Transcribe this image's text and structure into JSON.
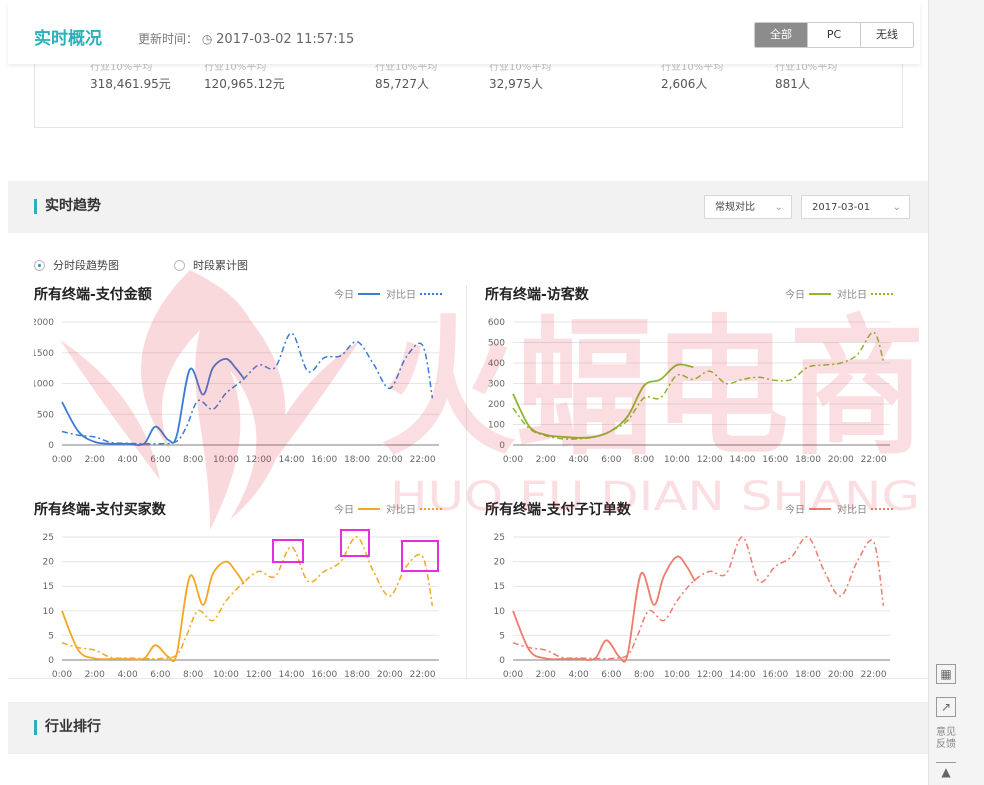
{
  "header": {
    "title": "实时概况",
    "updated_label": "更新时间：",
    "updated_time": "2017-03-02 11:57:15",
    "tabs": [
      "全部",
      "PC",
      "无线"
    ]
  },
  "metrics": [
    {
      "label": "行业10%平均",
      "value": "318,461.95元"
    },
    {
      "label": "行业10%平均",
      "value": "120,965.12元"
    },
    {
      "label": "行业10%平均",
      "value": "85,727人"
    },
    {
      "label": "行业10%平均",
      "value": "32,975人"
    },
    {
      "label": "行业10%平均",
      "value": "2,606人"
    },
    {
      "label": "行业10%平均",
      "value": "881人"
    }
  ],
  "trend": {
    "title": "实时趋势",
    "compare_select": "常规对比",
    "date_select": "2017-03-01",
    "radio_options": [
      "分时段趋势图",
      "时段累计图"
    ],
    "radio_selected": "分时段趋势图"
  },
  "legend": {
    "today": "今日",
    "compare": "对比日"
  },
  "colors": {
    "accent": "#2bb0b8",
    "blue": "#3a7bd5",
    "green": "#8db82e",
    "orange": "#f5a623",
    "red": "#f07a6b",
    "highlight": "#e52ee0"
  },
  "watermark": {
    "text_cn": "火蝠电商",
    "text_en": "HUO FU DIAN SHANG"
  },
  "rank": {
    "title": "行业排行"
  },
  "side_tools": [
    {
      "icon": "qrcode-icon",
      "label": ""
    },
    {
      "icon": "share-icon",
      "label": ""
    },
    {
      "icon": "feedback-icon",
      "label": "意见反馈"
    },
    {
      "icon": "back-to-top-icon",
      "label": ""
    }
  ],
  "chart_data": [
    {
      "type": "line",
      "title": "所有终端-支付金额",
      "x": [
        "0:00",
        "2:00",
        "4:00",
        "6:00",
        "8:00",
        "10:00",
        "12:00",
        "14:00",
        "16:00",
        "18:00",
        "20:00",
        "22:00"
      ],
      "ylim": [
        0,
        2000
      ],
      "yticks": [
        0,
        500,
        1000,
        1500,
        2000
      ],
      "series": [
        {
          "name": "今日",
          "style": "solid",
          "color": "#3a7bd5",
          "points": [
            [
              0,
              700
            ],
            [
              1,
              220
            ],
            [
              2,
              50
            ],
            [
              3,
              20
            ],
            [
              4,
              20
            ],
            [
              5,
              20
            ],
            [
              5.7,
              300
            ],
            [
              6.5,
              80
            ],
            [
              7,
              150
            ],
            [
              7.8,
              1230
            ],
            [
              8.6,
              820
            ],
            [
              9.2,
              1250
            ],
            [
              10,
              1400
            ],
            [
              10.6,
              1250
            ],
            [
              11.1,
              1080
            ]
          ]
        },
        {
          "name": "对比日",
          "style": "dashed",
          "color": "#3a7bd5",
          "points": [
            [
              0,
              220
            ],
            [
              1,
              160
            ],
            [
              2,
              130
            ],
            [
              3,
              40
            ],
            [
              4,
              30
            ],
            [
              5,
              20
            ],
            [
              6,
              20
            ],
            [
              7,
              60
            ],
            [
              7.6,
              300
            ],
            [
              8.3,
              720
            ],
            [
              9.2,
              580
            ],
            [
              10,
              840
            ],
            [
              11,
              1050
            ],
            [
              12,
              1300
            ],
            [
              13,
              1260
            ],
            [
              14,
              1820
            ],
            [
              15,
              1200
            ],
            [
              16,
              1420
            ],
            [
              17,
              1450
            ],
            [
              18,
              1680
            ],
            [
              19,
              1320
            ],
            [
              20,
              920
            ],
            [
              21,
              1430
            ],
            [
              22,
              1620
            ],
            [
              22.6,
              760
            ]
          ]
        }
      ]
    },
    {
      "type": "line",
      "title": "所有终端-访客数",
      "x": [
        "0:00",
        "2:00",
        "4:00",
        "6:00",
        "8:00",
        "10:00",
        "12:00",
        "14:00",
        "16:00",
        "18:00",
        "20:00",
        "22:00"
      ],
      "ylim": [
        0,
        600
      ],
      "yticks": [
        0,
        100,
        200,
        300,
        400,
        500,
        600
      ],
      "series": [
        {
          "name": "今日",
          "style": "solid",
          "color": "#8db82e",
          "points": [
            [
              0,
              250
            ],
            [
              1,
              90
            ],
            [
              2,
              50
            ],
            [
              3,
              40
            ],
            [
              4,
              35
            ],
            [
              5,
              40
            ],
            [
              6,
              70
            ],
            [
              7,
              140
            ],
            [
              8,
              290
            ],
            [
              9,
              320
            ],
            [
              10,
              390
            ],
            [
              11,
              380
            ]
          ]
        },
        {
          "name": "对比日",
          "style": "dashed",
          "color": "#8db82e",
          "points": [
            [
              0,
              180
            ],
            [
              1,
              80
            ],
            [
              2,
              45
            ],
            [
              3,
              30
            ],
            [
              4,
              30
            ],
            [
              5,
              40
            ],
            [
              6,
              70
            ],
            [
              7,
              120
            ],
            [
              8,
              230
            ],
            [
              9,
              230
            ],
            [
              10,
              340
            ],
            [
              11,
              320
            ],
            [
              12,
              360
            ],
            [
              13,
              300
            ],
            [
              14,
              320
            ],
            [
              15,
              330
            ],
            [
              16,
              315
            ],
            [
              17,
              320
            ],
            [
              18,
              380
            ],
            [
              19,
              390
            ],
            [
              20,
              400
            ],
            [
              21,
              440
            ],
            [
              22,
              550
            ],
            [
              22.6,
              410
            ]
          ]
        }
      ]
    },
    {
      "type": "line",
      "title": "所有终端-支付买家数",
      "x": [
        "0:00",
        "2:00",
        "4:00",
        "6:00",
        "8:00",
        "10:00",
        "12:00",
        "14:00",
        "16:00",
        "18:00",
        "20:00",
        "22:00"
      ],
      "ylim": [
        0,
        25
      ],
      "yticks": [
        0,
        5,
        10,
        15,
        20,
        25
      ],
      "series": [
        {
          "name": "今日",
          "style": "solid",
          "color": "#f5a623",
          "points": [
            [
              0,
              10
            ],
            [
              1,
              2
            ],
            [
              2,
              0.3
            ],
            [
              3,
              0.2
            ],
            [
              4,
              0.2
            ],
            [
              5,
              0.3
            ],
            [
              5.7,
              3
            ],
            [
              6.5,
              0.6
            ],
            [
              7,
              1.2
            ],
            [
              7.8,
              17
            ],
            [
              8.6,
              11.2
            ],
            [
              9.2,
              17.5
            ],
            [
              10,
              20
            ],
            [
              10.6,
              18
            ],
            [
              11.1,
              15.5
            ]
          ]
        },
        {
          "name": "对比日",
          "style": "dashed",
          "color": "#f5a623",
          "points": [
            [
              0,
              3.5
            ],
            [
              1,
              2.5
            ],
            [
              2,
              2
            ],
            [
              3,
              0.5
            ],
            [
              4,
              0.4
            ],
            [
              5,
              0.3
            ],
            [
              6,
              0.3
            ],
            [
              7,
              1
            ],
            [
              7.6,
              5
            ],
            [
              8.3,
              10
            ],
            [
              9.2,
              8
            ],
            [
              10,
              12
            ],
            [
              11,
              15.5
            ],
            [
              12,
              18
            ],
            [
              13,
              17
            ],
            [
              14,
              23
            ],
            [
              15,
              16
            ],
            [
              16,
              18
            ],
            [
              17,
              20
            ],
            [
              18,
              25
            ],
            [
              19,
              18
            ],
            [
              20,
              13
            ],
            [
              21,
              19
            ],
            [
              22,
              21
            ],
            [
              22.6,
              11
            ]
          ]
        }
      ],
      "annotations": [
        {
          "at": "14:00"
        },
        {
          "at": "18:00"
        },
        {
          "at": "22:00"
        }
      ]
    },
    {
      "type": "line",
      "title": "所有终端-支付子订单数",
      "x": [
        "0:00",
        "2:00",
        "4:00",
        "6:00",
        "8:00",
        "10:00",
        "12:00",
        "14:00",
        "16:00",
        "18:00",
        "20:00",
        "22:00"
      ],
      "ylim": [
        0,
        25
      ],
      "yticks": [
        0,
        5,
        10,
        15,
        20,
        25
      ],
      "series": [
        {
          "name": "今日",
          "style": "solid",
          "color": "#f07a6b",
          "points": [
            [
              0,
              10
            ],
            [
              1,
              2
            ],
            [
              2,
              0.3
            ],
            [
              3,
              0.2
            ],
            [
              4,
              0.2
            ],
            [
              5,
              0.3
            ],
            [
              5.7,
              4
            ],
            [
              6.5,
              0.6
            ],
            [
              7,
              1.2
            ],
            [
              7.8,
              17.5
            ],
            [
              8.6,
              11.2
            ],
            [
              9.2,
              17
            ],
            [
              10,
              21
            ],
            [
              10.6,
              19
            ],
            [
              11.1,
              16
            ]
          ]
        },
        {
          "name": "对比日",
          "style": "dashed",
          "color": "#f07a6b",
          "points": [
            [
              0,
              3.5
            ],
            [
              1,
              2.5
            ],
            [
              2,
              2
            ],
            [
              3,
              0.5
            ],
            [
              4,
              0.4
            ],
            [
              5,
              0.3
            ],
            [
              6,
              0.3
            ],
            [
              7,
              1
            ],
            [
              7.6,
              5
            ],
            [
              8.3,
              10
            ],
            [
              9.2,
              8
            ],
            [
              10,
              12
            ],
            [
              11,
              16
            ],
            [
              12,
              18
            ],
            [
              13,
              17.5
            ],
            [
              14,
              25
            ],
            [
              15,
              16
            ],
            [
              16,
              19
            ],
            [
              17,
              21
            ],
            [
              18,
              25
            ],
            [
              19,
              18
            ],
            [
              20,
              13
            ],
            [
              21,
              20
            ],
            [
              22,
              24
            ],
            [
              22.6,
              11
            ]
          ]
        }
      ]
    }
  ]
}
